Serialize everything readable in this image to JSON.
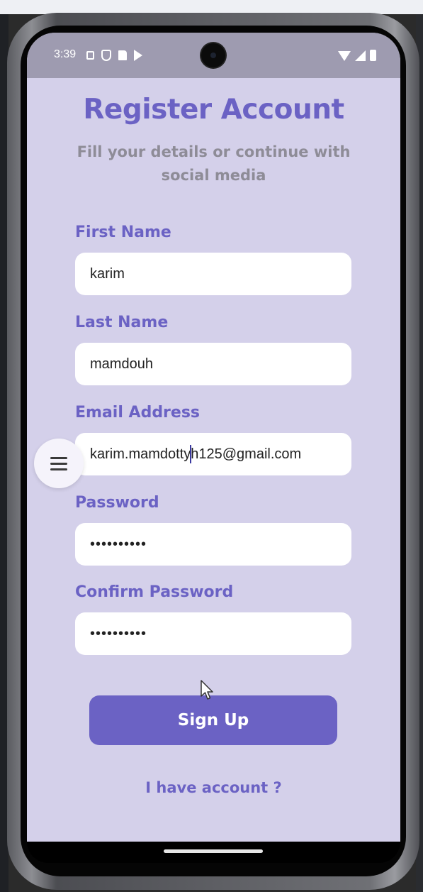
{
  "status_bar": {
    "time": "3:39",
    "icons_left": [
      "screen-icon",
      "shield-icon",
      "sd-card-icon",
      "play-store-icon"
    ],
    "icons_right": [
      "wifi-icon",
      "signal-icon",
      "battery-icon"
    ]
  },
  "page": {
    "title": "Register Account",
    "subtitle": "Fill your details or continue with social media"
  },
  "form": {
    "first_name": {
      "label": "First Name",
      "value": "karim"
    },
    "last_name": {
      "label": "Last Name",
      "value": "mamdouh"
    },
    "email": {
      "label": "Email Address",
      "value_before_cursor": "karim.mamdotty",
      "value_after_cursor": "h125@gmail.com"
    },
    "password": {
      "label": "Password",
      "value": "••••••••••"
    },
    "confirm_password": {
      "label": "Confirm Password",
      "value": "••••••••••"
    }
  },
  "actions": {
    "signup_label": "Sign Up",
    "have_account_label": "I have account ?"
  },
  "fab": {
    "icon": "menu-icon"
  },
  "colors": {
    "accent": "#6b62c4",
    "screen_bg": "#d4d0ea",
    "subtitle": "#8e8c97",
    "input_bg": "#ffffff"
  }
}
